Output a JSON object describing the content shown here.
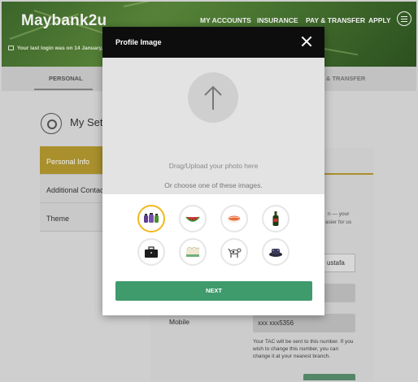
{
  "app": {
    "logo": "Maybank2u",
    "nav": [
      "MY ACCOUNTS",
      "INSURANCE",
      "PAY & TRANSFER",
      "APPLY"
    ],
    "last_login": "Your last login was on 14 January,"
  },
  "tabs": {
    "personal": "PERSONAL",
    "pay_transfer_fragment": "Y & TRANSFER"
  },
  "settings": {
    "title": "My Setti",
    "menu": [
      "Personal Info",
      "Additional Contac",
      "Theme"
    ],
    "active_index": 0
  },
  "panel": {
    "text_fragment_1": "n — your",
    "text_fragment_2": "asier for us",
    "name_fragment": "ustafa",
    "mobile_label": "Mobile",
    "mobile_value": "xxx xxx5356",
    "tac_note": "Your TAC will be sent to this number. If you wish to change this number, you can change it at your nearest branch."
  },
  "modal": {
    "title": "Profile Image",
    "upload_text": "Drag/Upload your photo here",
    "choose_text": "Or choose one of these images.",
    "images": [
      {
        "icon": "jars-icon",
        "selected": true
      },
      {
        "icon": "watermelon-icon",
        "selected": false
      },
      {
        "icon": "sushi-icon",
        "selected": false
      },
      {
        "icon": "bottle-icon",
        "selected": false
      },
      {
        "icon": "briefcase-icon",
        "selected": false
      },
      {
        "icon": "cake-icon",
        "selected": false
      },
      {
        "icon": "dog-icon",
        "selected": false
      },
      {
        "icon": "hat-icon",
        "selected": false
      }
    ],
    "next_label": "NEXT"
  },
  "colors": {
    "accent_green": "#3f9a6c",
    "selected_ring": "#f2b81c",
    "active_menu": "#b49a30",
    "modal_header": "#0d0d0d"
  }
}
